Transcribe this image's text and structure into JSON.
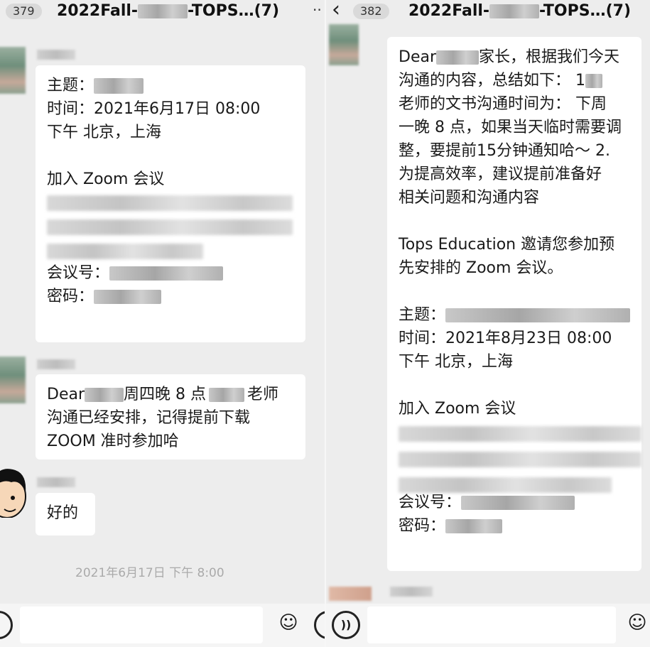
{
  "left": {
    "unread_badge": "379",
    "title_prefix": "2022Fall-",
    "title_suffix": "-TOPS…(7)",
    "more": "··",
    "message1": {
      "line1": "主题：",
      "line2": "时间：2021年6月17日 08:00",
      "line3": "下午 北京，上海",
      "line4": "加入 Zoom 会议",
      "line5": "会议号：",
      "line6": "密码："
    },
    "message2": {
      "line1a": "Dear",
      "line1b": "周四晚 8 点",
      "line1c": "老师",
      "line2": "沟通已经安排，记得提前下载",
      "line3": "ZOOM 准时参加哈"
    },
    "reply": "好的",
    "timestamp": "2021年6月17日 下午 8:00"
  },
  "right": {
    "unread_badge": "382",
    "title_prefix": "2022Fall-",
    "title_suffix": "-TOPS…(7)",
    "message": {
      "line1a": "Dear",
      "line1b": "家长，根据我们今天",
      "line2a": "沟通的内容，总结如下： 1",
      "line3": "老师的文书沟通时间为： 下周",
      "line4": "一晚 8 点，如果当天临时需要调",
      "line5": "整，要提前15分钟通知哈～ 2.",
      "line6": "为提高效率，建议提前准备好",
      "line7": "相关问题和沟通内容",
      "line8": "Tops Education 邀请您参加预",
      "line9": "先安排的 Zoom 会议。",
      "line10": "主题：",
      "line11": "时间：2021年8月23日 08:00",
      "line12": "下午 北京，上海",
      "line13": "加入 Zoom 会议",
      "line14": "会议号：",
      "line15": "密码："
    }
  },
  "icons": {
    "back": "‹",
    "emoji": "☺",
    "voice": "))"
  }
}
